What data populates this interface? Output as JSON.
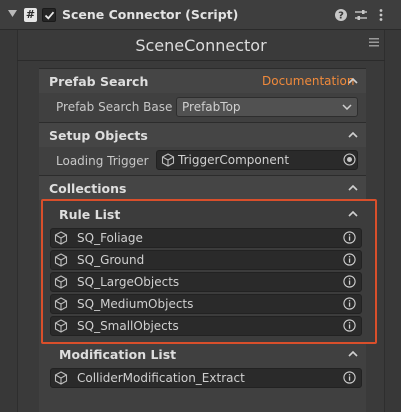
{
  "component": {
    "title": "Scene Connector (Script)",
    "script_glyph": "#"
  },
  "panel": {
    "title": "SceneConnector"
  },
  "sections": {
    "prefab_search": {
      "title": "Prefab Search",
      "doc_link": "Documentation",
      "field_label": "Prefab Search Base",
      "field_value": "PrefabTop"
    },
    "setup_objects": {
      "title": "Setup Objects",
      "field_label": "Loading Trigger",
      "field_value": "TriggerComponent"
    },
    "collections": {
      "title": "Collections"
    },
    "rule_list": {
      "title": "Rule List",
      "items": [
        "SQ_Foliage",
        "SQ_Ground",
        "SQ_LargeObjects",
        "SQ_MediumObjects",
        "SQ_SmallObjects"
      ]
    },
    "modification_list": {
      "title": "Modification List",
      "items": [
        "ColliderModification_Extract"
      ]
    }
  },
  "colors": {
    "highlight": "#d94f2b",
    "doc_link": "#f08a3c"
  }
}
